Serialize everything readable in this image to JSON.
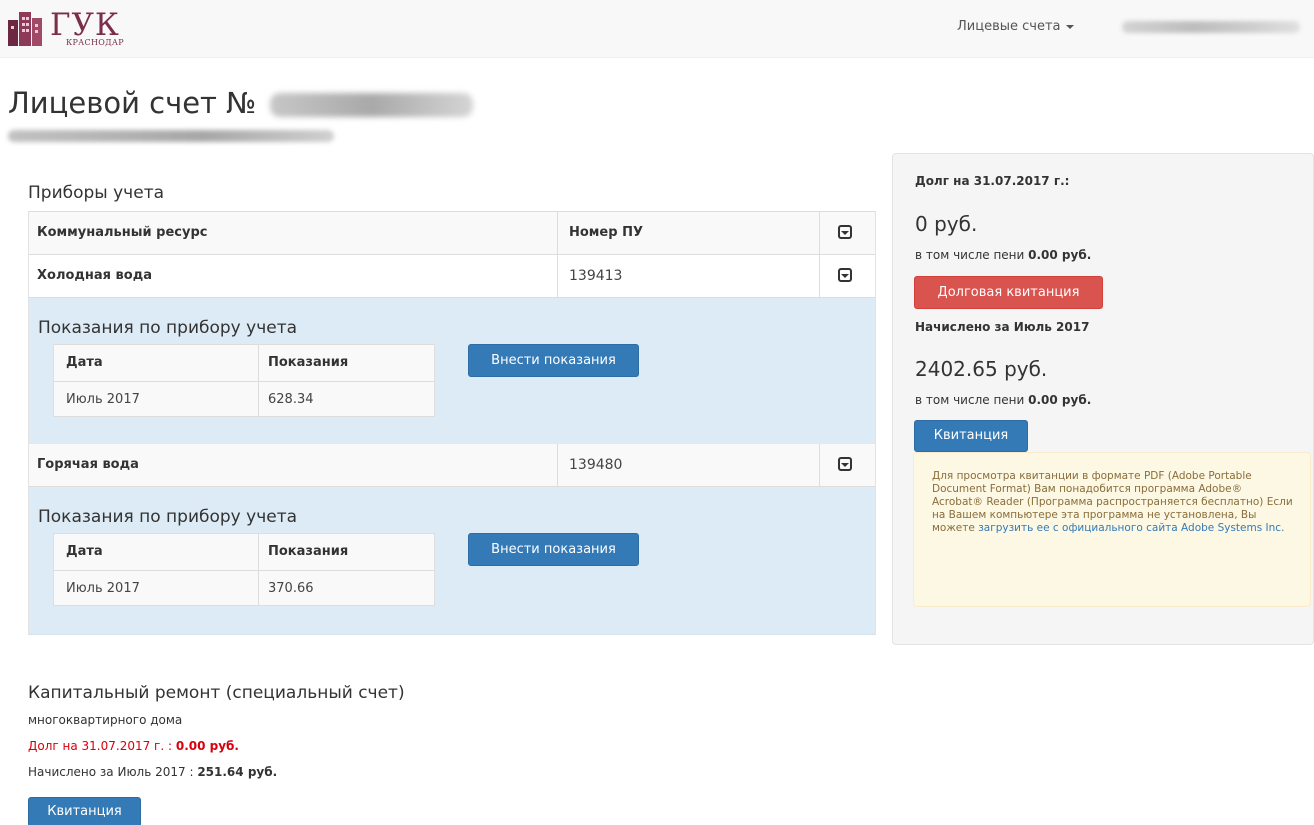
{
  "navbar": {
    "logo_text": "ГУК",
    "logo_subtext": "КРАСНОДАР",
    "accounts_menu": "Лицевые счета"
  },
  "page": {
    "title": "Лицевой счет №"
  },
  "meters": {
    "section_title": "Приборы учета",
    "headers": {
      "resource": "Коммунальный ресурс",
      "number": "Номер ПУ"
    },
    "items": [
      {
        "resource": "Холодная вода",
        "number": "139413",
        "readings_title": "Показания по прибору учета",
        "col_date": "Дата",
        "col_value": "Показания",
        "date": "Июль 2017",
        "value": "628.34",
        "button": "Внести показания"
      },
      {
        "resource": "Горячая вода",
        "number": "139480",
        "readings_title": "Показания по прибору учета",
        "col_date": "Дата",
        "col_value": "Показания",
        "date": "Июль 2017",
        "value": "370.66",
        "button": "Внести показания"
      }
    ]
  },
  "summary": {
    "debt_label": "Долг на 31.07.2017 г.:",
    "debt_amount": "0 руб.",
    "penalty_prefix": "в том числе пени",
    "debt_penalty": "0.00 руб.",
    "debt_button": "Долговая квитанция",
    "charged_label": "Начислено за Июль 2017",
    "charged_amount": "2402.65 руб.",
    "charged_penalty": "0.00 руб.",
    "receipt_button": "Квитанция",
    "note_text": "Для просмотра квитанции в формате PDF (Adobe Portable Document Format) Вам понадобится программа Adobe® Acrobat® Reader (Программа распространяется бесплатно) Если на Вашем компьютере эта программа не установлена, Вы можете",
    "note_link": "загрузить ее с официального сайта Adobe Systems Inc."
  },
  "capital": {
    "title": "Капитальный ремонт (специальный счет)",
    "subtitle": "многоквартирного дома",
    "debt_label": "Долг на 31.07.2017 г. :",
    "debt_value": "0.00 руб.",
    "charged_label": "Начислено за Июль 2017 :",
    "charged_value": "251.64 руб.",
    "button": "Квитанция"
  },
  "colors": {
    "primary": "#337ab7",
    "danger": "#d9534f",
    "logo": "#7a2e4a",
    "detail_bg": "#dcebf5"
  }
}
